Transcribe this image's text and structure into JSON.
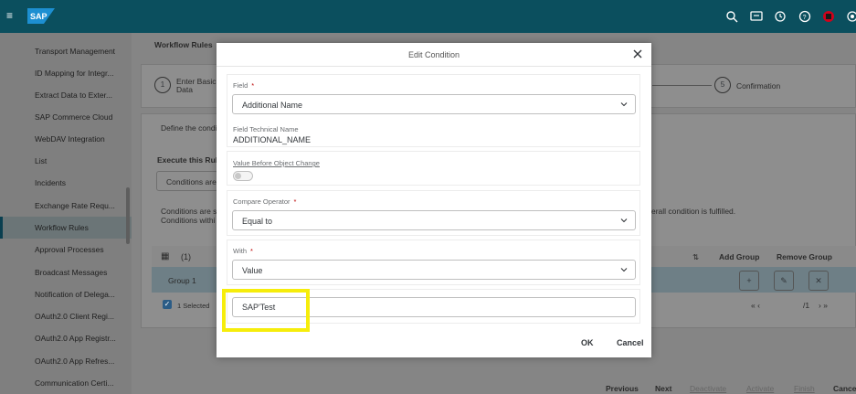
{
  "shell": {
    "logo_text": "SAP"
  },
  "sidebar": {
    "items": [
      {
        "label": "Transport Management"
      },
      {
        "label": "ID Mapping for Integr..."
      },
      {
        "label": "Extract Data to Exter..."
      },
      {
        "label": "SAP Commerce Cloud"
      },
      {
        "label": "WebDAV Integration"
      },
      {
        "label": "List"
      },
      {
        "label": "Incidents"
      },
      {
        "label": "Exchange Rate Requ..."
      },
      {
        "label": "Workflow Rules"
      },
      {
        "label": "Approval Processes"
      },
      {
        "label": "Broadcast Messages"
      },
      {
        "label": "Notification of Delega..."
      },
      {
        "label": "OAuth2.0 Client Regi..."
      },
      {
        "label": "OAuth2.0 App Registr..."
      },
      {
        "label": "OAuth2.0 App Refres..."
      },
      {
        "label": "Communication Certi..."
      }
    ]
  },
  "background": {
    "page_title": "Workflow Rules",
    "step1_num": "1",
    "step1_label_line1": "Enter Basic",
    "step1_label_line2": "Data",
    "step5_num": "5",
    "step5_label": "Confirmation",
    "define_text": "Define the condi",
    "execute_text": "Execute this Rul",
    "conditions_button": "Conditions are",
    "conditions_text_line1": "Conditions are s",
    "conditions_text_line2": "Conditions withi",
    "overall_text": "erall condition is fulfilled.",
    "table_count": "(1)",
    "add_group": "Add Group",
    "remove_group": "Remove Group",
    "group_label": "Group 1",
    "selected_text": "1 Selected",
    "pager_text": "/1",
    "wizard_buttons": {
      "previous": "Previous",
      "next": "Next",
      "deactivate": "Deactivate",
      "activate": "Activate",
      "finish": "Finish",
      "cancel": "Cance"
    }
  },
  "dialog": {
    "title": "Edit Condition",
    "field_label": "Field",
    "field_value": "Additional Name",
    "technical_name_label": "Field Technical Name",
    "technical_name_value": "ADDITIONAL_NAME",
    "value_before_label": "Value Before Object Change",
    "compare_operator_label": "Compare Operator",
    "compare_operator_value": "Equal to",
    "with_label": "With",
    "with_value": "Value",
    "value_input": "SAP'Test",
    "ok_label": "OK",
    "cancel_label": "Cancel",
    "required_mark": "*"
  },
  "colors": {
    "shell": "#0b4f5e",
    "highlight": "#f6ed0b",
    "required": "#bb0000"
  }
}
